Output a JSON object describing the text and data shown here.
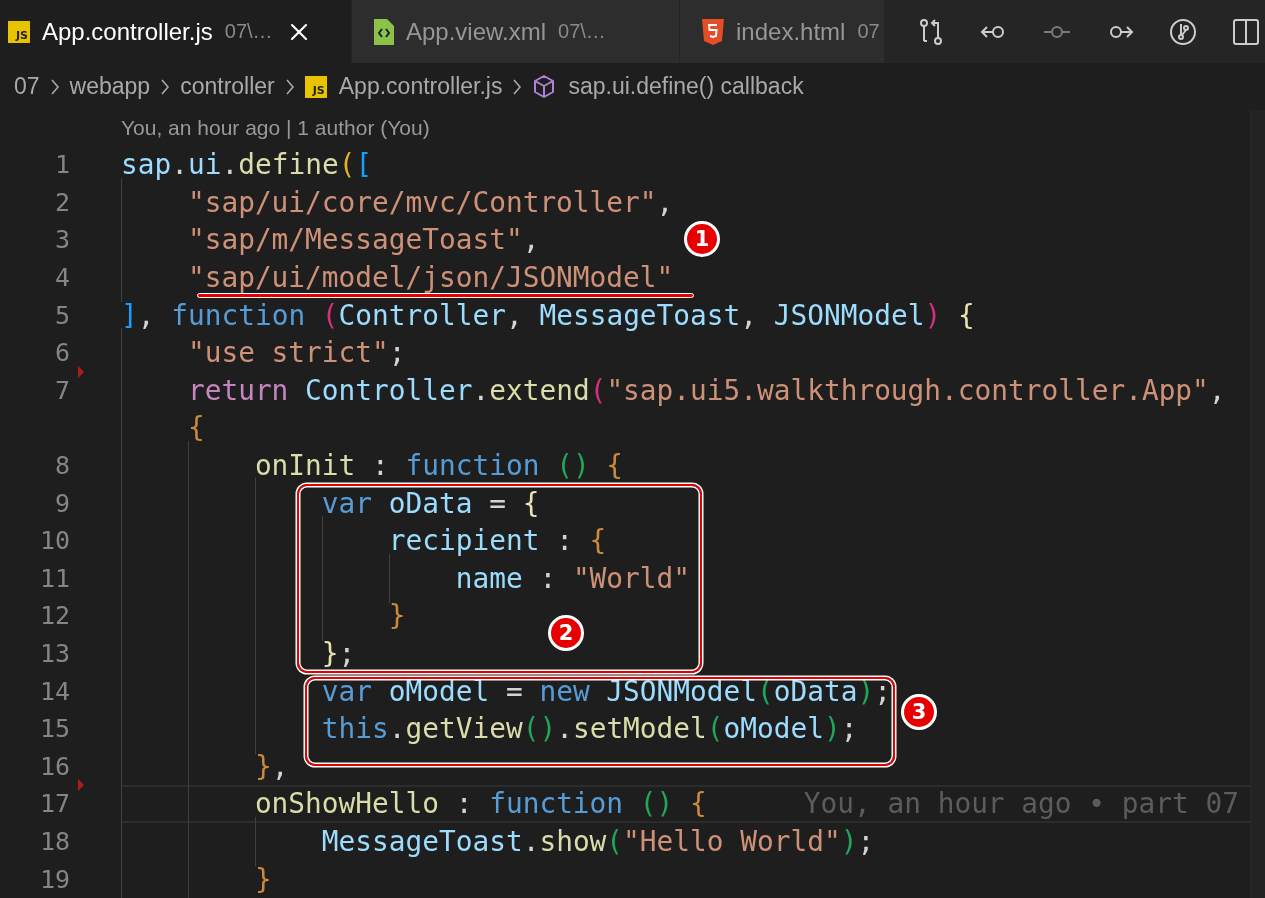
{
  "tabs": [
    {
      "kind": "js",
      "icon_text": "JS",
      "label": "App.controller.js",
      "path": "07\\…",
      "selected": true,
      "close": true
    },
    {
      "kind": "xml",
      "label": "App.view.xml",
      "path": "07\\…",
      "selected": false,
      "close": false
    },
    {
      "kind": "html",
      "label": "index.html",
      "path": "07",
      "selected": false,
      "close": false
    }
  ],
  "breadcrumb": [
    {
      "label": "07"
    },
    {
      "label": "webapp"
    },
    {
      "label": "controller"
    },
    {
      "label": "App.controller.js",
      "kind": "js",
      "icon_text": "JS"
    },
    {
      "label": "sap.ui.define() callback",
      "kind": "symbol"
    }
  ],
  "codelens": "You, an hour ago | 1 author (You)",
  "lines": [
    {
      "number": "1",
      "current": false,
      "marker": false,
      "tokens": [
        {
          "text": "sap",
          "kind": "var"
        },
        {
          "text": ".",
          "kind": "p"
        },
        {
          "text": "ui",
          "kind": "var"
        },
        {
          "text": ".",
          "kind": "p"
        },
        {
          "text": "define",
          "kind": "fn"
        },
        {
          "text": "(",
          "kind": "b1"
        },
        {
          "text": "[",
          "kind": "b3"
        }
      ]
    },
    {
      "number": "2",
      "current": false,
      "marker": false,
      "tokens": [
        {
          "text": "    \"sap/ui/core/mvc/Controller\"",
          "kind": "str"
        },
        {
          "text": ",",
          "kind": "p"
        }
      ]
    },
    {
      "number": "3",
      "current": false,
      "marker": false,
      "tokens": [
        {
          "text": "    \"sap/m/MessageToast\"",
          "kind": "str"
        },
        {
          "text": ",",
          "kind": "p"
        }
      ]
    },
    {
      "number": "4",
      "current": false,
      "marker": false,
      "tokens": [
        {
          "text": "    \"sap/ui/model/json/JSONModel\"",
          "kind": "str"
        }
      ]
    },
    {
      "number": "5",
      "current": false,
      "marker": false,
      "tokens": [
        {
          "text": "]",
          "kind": "b3"
        },
        {
          "text": ", ",
          "kind": "p"
        },
        {
          "text": "function ",
          "kind": "kw"
        },
        {
          "text": "(",
          "kind": "b2"
        },
        {
          "text": "Controller",
          "kind": "var"
        },
        {
          "text": ", ",
          "kind": "p"
        },
        {
          "text": "MessageToast",
          "kind": "var"
        },
        {
          "text": ", ",
          "kind": "p"
        },
        {
          "text": "JSONModel",
          "kind": "var"
        },
        {
          "text": ")",
          "kind": "b2"
        },
        {
          "text": " {",
          "kind": "b6"
        }
      ]
    },
    {
      "number": "6",
      "current": false,
      "marker": true,
      "tokens": [
        {
          "text": "    \"use strict\"",
          "kind": "str"
        },
        {
          "text": ";",
          "kind": "p"
        }
      ]
    },
    {
      "number": "7",
      "current": false,
      "marker": false,
      "tokens": [
        {
          "text": "    return ",
          "kind": "ctrl"
        },
        {
          "text": "Controller",
          "kind": "var"
        },
        {
          "text": ".",
          "kind": "p"
        },
        {
          "text": "extend",
          "kind": "fn"
        },
        {
          "text": "(",
          "kind": "b2"
        },
        {
          "text": "\"sap.ui5.walkthrough.controller.App\"",
          "kind": "str"
        },
        {
          "text": ",",
          "kind": "p"
        }
      ],
      "continuation": [
        {
          "text": "    {",
          "kind": "b5"
        }
      ]
    },
    {
      "number": "8",
      "current": false,
      "marker": false,
      "tokens": [
        {
          "text": "        onInit",
          "kind": "fn"
        },
        {
          "text": " : ",
          "kind": "p"
        },
        {
          "text": "function ",
          "kind": "kw"
        },
        {
          "text": "()",
          "kind": "b4"
        },
        {
          "text": " {",
          "kind": "b5"
        }
      ]
    },
    {
      "number": "9",
      "current": false,
      "marker": false,
      "tokens": [
        {
          "text": "            var ",
          "kind": "kw"
        },
        {
          "text": "oData",
          "kind": "var"
        },
        {
          "text": " = ",
          "kind": "p"
        },
        {
          "text": "{",
          "kind": "b6"
        }
      ]
    },
    {
      "number": "10",
      "current": false,
      "marker": false,
      "tokens": [
        {
          "text": "                recipient",
          "kind": "var"
        },
        {
          "text": " : ",
          "kind": "p"
        },
        {
          "text": "{",
          "kind": "b5"
        }
      ]
    },
    {
      "number": "11",
      "current": false,
      "marker": false,
      "tokens": [
        {
          "text": "                    name",
          "kind": "var"
        },
        {
          "text": " : ",
          "kind": "p"
        },
        {
          "text": "\"World\"",
          "kind": "str"
        }
      ]
    },
    {
      "number": "12",
      "current": false,
      "marker": false,
      "tokens": [
        {
          "text": "                }",
          "kind": "b5"
        }
      ]
    },
    {
      "number": "13",
      "current": false,
      "marker": false,
      "tokens": [
        {
          "text": "            }",
          "kind": "b6"
        },
        {
          "text": ";",
          "kind": "p"
        }
      ]
    },
    {
      "number": "14",
      "current": false,
      "marker": false,
      "tokens": [
        {
          "text": "            var ",
          "kind": "kw"
        },
        {
          "text": "oModel",
          "kind": "var"
        },
        {
          "text": " = ",
          "kind": "p"
        },
        {
          "text": "new ",
          "kind": "kw"
        },
        {
          "text": "JSONModel",
          "kind": "var"
        },
        {
          "text": "(",
          "kind": "b4"
        },
        {
          "text": "oData",
          "kind": "var"
        },
        {
          "text": ")",
          "kind": "b4"
        },
        {
          "text": ";",
          "kind": "p"
        }
      ]
    },
    {
      "number": "15",
      "current": false,
      "marker": false,
      "tokens": [
        {
          "text": "            this",
          "kind": "kw"
        },
        {
          "text": ".",
          "kind": "p"
        },
        {
          "text": "getView",
          "kind": "fn"
        },
        {
          "text": "()",
          "kind": "b4"
        },
        {
          "text": ".",
          "kind": "p"
        },
        {
          "text": "setModel",
          "kind": "fn"
        },
        {
          "text": "(",
          "kind": "b4"
        },
        {
          "text": "oModel",
          "kind": "var"
        },
        {
          "text": ")",
          "kind": "b4"
        },
        {
          "text": ";",
          "kind": "p"
        }
      ]
    },
    {
      "number": "16",
      "current": false,
      "marker": true,
      "tokens": [
        {
          "text": "        }",
          "kind": "b5"
        },
        {
          "text": ",",
          "kind": "p"
        }
      ]
    },
    {
      "number": "17",
      "current": true,
      "marker": false,
      "tokens": [
        {
          "text": "        onShowHello",
          "kind": "fn"
        },
        {
          "text": " : ",
          "kind": "p"
        },
        {
          "text": "function ",
          "kind": "kw"
        },
        {
          "text": "()",
          "kind": "b4"
        },
        {
          "text": " {",
          "kind": "b5"
        }
      ],
      "blame": "You, an hour ago • part 07"
    },
    {
      "number": "18",
      "current": false,
      "marker": false,
      "tokens": [
        {
          "text": "            MessageToast",
          "kind": "var"
        },
        {
          "text": ".",
          "kind": "p"
        },
        {
          "text": "show",
          "kind": "fn"
        },
        {
          "text": "(",
          "kind": "b4"
        },
        {
          "text": "\"Hello World\"",
          "kind": "str"
        },
        {
          "text": ")",
          "kind": "b4"
        },
        {
          "text": ";",
          "kind": "p"
        }
      ]
    },
    {
      "number": "19",
      "current": false,
      "marker": false,
      "tokens": [
        {
          "text": "        }",
          "kind": "b5"
        }
      ]
    }
  ],
  "annotations": [
    {
      "kind": "underline",
      "label": "1"
    },
    {
      "kind": "box",
      "label": "2"
    },
    {
      "kind": "box",
      "label": "3"
    }
  ]
}
